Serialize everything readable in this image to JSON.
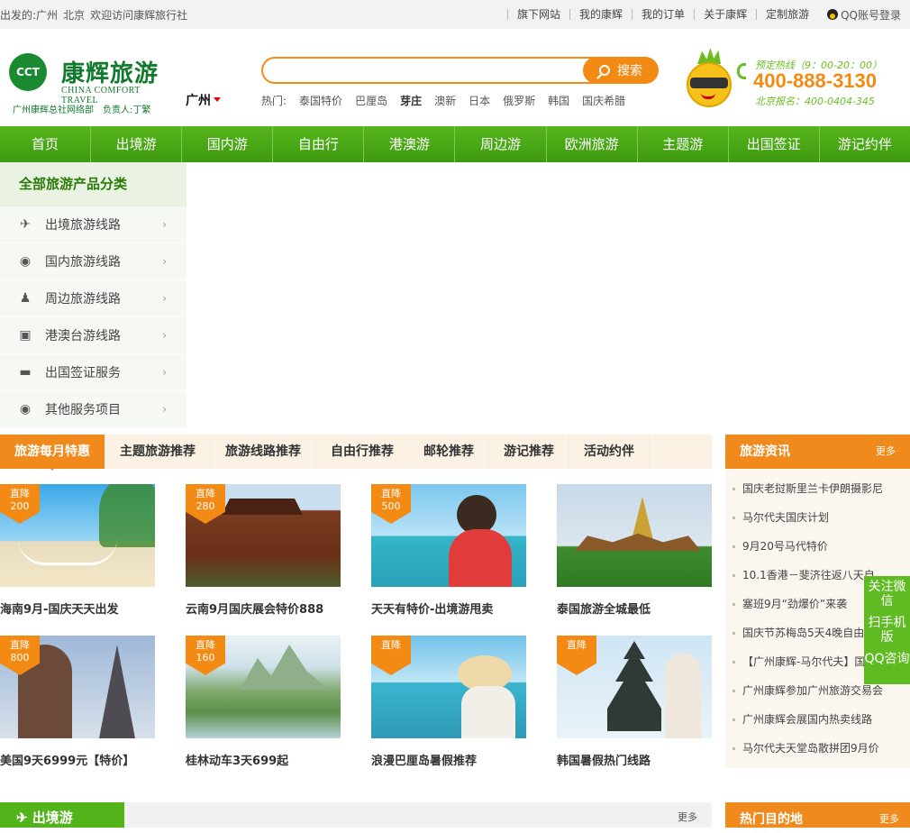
{
  "topbar": {
    "left": [
      "出发的:广州",
      "北京",
      "欢迎访问康辉旅行社"
    ],
    "links": [
      "旗下网站",
      "我的康辉",
      "我的订单",
      "关于康辉",
      "定制旅游"
    ],
    "qq_login": "QQ账号登录"
  },
  "logo": {
    "badge": "CCT",
    "cn": "康辉旅游",
    "en": "CHINA COMFORT TRAVEL",
    "sub1": "广州康辉总社网络部",
    "sub2": "负责人:丁繁"
  },
  "city": "广州",
  "search": {
    "placeholder": "",
    "button": "搜索"
  },
  "hot": {
    "label": "热门:",
    "items": [
      "泰国特价",
      "巴厘岛",
      "芽庄",
      "澳新",
      "日本",
      "俄罗斯",
      "韩国",
      "国庆希腊"
    ]
  },
  "hotline": {
    "label": "预定热线（9：00-20：00）",
    "phone": "400-888-3130",
    "beijing": "北京报名：400-0404-345"
  },
  "nav": [
    "首页",
    "出境游",
    "国内游",
    "自由行",
    "港澳游",
    "周边游",
    "欧洲旅游",
    "主题游",
    "出国签证",
    "游记约伴"
  ],
  "category": {
    "title": "全部旅游产品分类",
    "items": [
      {
        "label": "出境旅游线路",
        "icon": "plane-icon"
      },
      {
        "label": "国内旅游线路",
        "icon": "globe-icon"
      },
      {
        "label": "周边旅游线路",
        "icon": "people-icon"
      },
      {
        "label": "港澳台游线路",
        "icon": "bus-icon"
      },
      {
        "label": "出国签证服务",
        "icon": "car-icon"
      },
      {
        "label": "其他服务项目",
        "icon": "globe-icon"
      }
    ]
  },
  "tabs": [
    "旅游每月特惠",
    "主题旅游推荐",
    "旅游线路推荐",
    "自由行推荐",
    "邮轮推荐",
    "游记推荐",
    "活动约伴"
  ],
  "cards": [
    {
      "caption": "海南9月-国庆天天出发",
      "badge": "直降",
      "amount": "200"
    },
    {
      "caption": "云南9月国庆展会特价888",
      "badge": "直降",
      "amount": "280"
    },
    {
      "caption": "天天有特价-出境游甩卖",
      "badge": "直降",
      "amount": "500"
    },
    {
      "caption": "泰国旅游全城最低",
      "badge": "",
      "amount": ""
    },
    {
      "caption": "美国9天6999元【特价】",
      "badge": "直降",
      "amount": "800"
    },
    {
      "caption": "桂林动车3天699起",
      "badge": "直降",
      "amount": "160"
    },
    {
      "caption": "浪漫巴厘岛暑假推荐",
      "badge": "直降",
      "amount": ""
    },
    {
      "caption": "韩国暑假热门线路",
      "badge": "直降",
      "amount": ""
    }
  ],
  "news": {
    "title": "旅游资讯",
    "more": "更多",
    "items": [
      "国庆老挝斯里兰卡伊朗摄影尼",
      "马尔代夫国庆计划",
      "9月20号马代特价",
      "10.1香港－斐济往返八天自",
      "塞班9月“劲爆价”来袭",
      "国庆节苏梅岛5天4晚自由行",
      "【广州康辉-马尔代夫】国",
      "广州康辉参加广州旅游交易会",
      "广州康辉会展国内热卖线路",
      "马尔代夫天堂岛散拼团9月价"
    ]
  },
  "float": [
    "关注微信",
    "扫手机版",
    "QQ咨询"
  ],
  "section": {
    "title": "出境游",
    "more": "更多"
  },
  "section2": {
    "title": "热门目的地",
    "more": "更多"
  },
  "colors": {
    "green": "#4aa816",
    "orange": "#f08a1c"
  }
}
